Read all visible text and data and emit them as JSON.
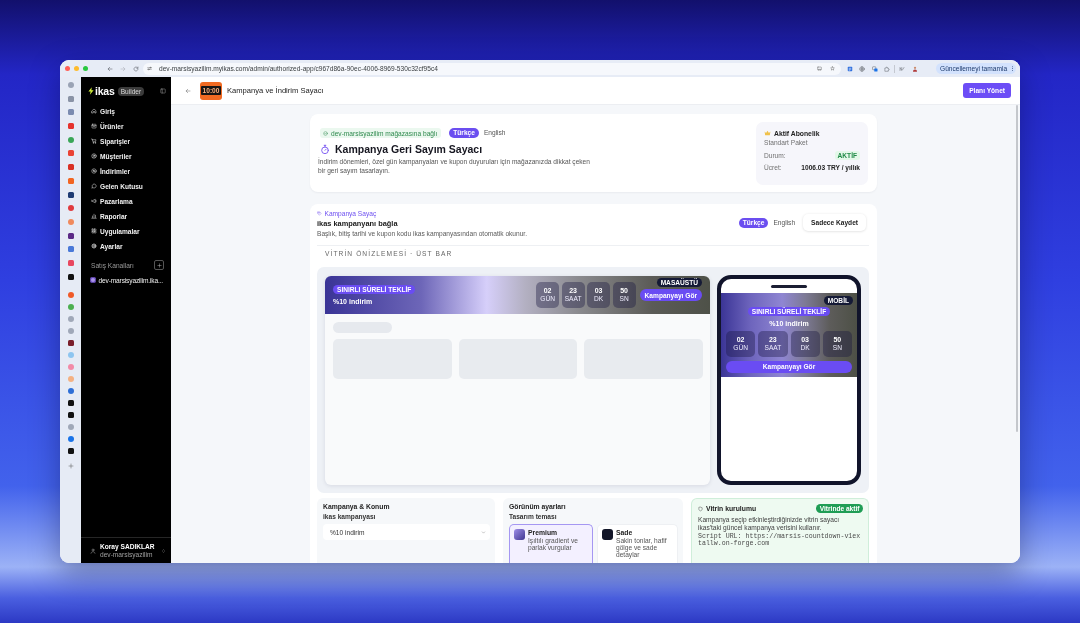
{
  "browser": {
    "url": "dev-marsisyazilim.myikas.com/admin/authorized-app/c967d86a-90ec-4006-8969-530c32cf95c4",
    "update_button": "Güncellemeyi tamamla"
  },
  "sidebar": {
    "brand": "ikas",
    "badge": "Builder",
    "items": [
      {
        "label": "Giriş"
      },
      {
        "label": "Ürünler"
      },
      {
        "label": "Siparişler"
      },
      {
        "label": "Müşteriler"
      },
      {
        "label": "İndirimler"
      },
      {
        "label": "Gelen Kutusu"
      },
      {
        "label": "Pazarlama"
      },
      {
        "label": "Raporlar"
      },
      {
        "label": "Uygulamalar"
      },
      {
        "label": "Ayarlar"
      }
    ],
    "channels_title": "Satış Kanalları",
    "channels": [
      {
        "label": "dev-marsisyazilim.ika..."
      }
    ],
    "user": {
      "name": "Koray SADIKLAR",
      "store": "dev-marsisyazilim"
    }
  },
  "header": {
    "app_icon_text": "10:00",
    "title": "Kampanya ve İndirim Sayacı",
    "button": "Planı Yönet"
  },
  "hero": {
    "connection": "dev-marsisyazilim mağazasına bağlı",
    "languages": [
      {
        "label": "Türkçe",
        "selected": true
      },
      {
        "label": "English",
        "selected": false
      }
    ],
    "title": "Kampanya Geri Sayım Sayacı",
    "description_lines": [
      "İndirim dönemleri, özel gün kampanyaları ve kupon duyuruları için mağazanızda dikkat çeken",
      "bir geri sayım tasarlayın."
    ]
  },
  "subscription": {
    "title": "Aktif Abonelik",
    "plan": "Standart Paket",
    "rows": [
      {
        "label": "Durum:",
        "value": "AKTİF",
        "kind": "badge"
      },
      {
        "label": "Ücret:",
        "value": "1006.03 TRY / yıllık",
        "kind": "text"
      }
    ]
  },
  "campaign": {
    "eyebrow": "Kampanya Sayaç",
    "title": "ikas kampanyanı bağla",
    "description": "Başlık, bitiş tarihi ve kupon kodu ikas kampanyasından otomatik okunur.",
    "languages": [
      {
        "label": "Türkçe",
        "selected": true
      },
      {
        "label": "English",
        "selected": false
      }
    ],
    "save_button": "Sadece Kaydet",
    "preview_label": "VİTRİN ÖNİZLEMESİ · ÜST BAR"
  },
  "preview": {
    "desktop": {
      "badge": "MASAÜSTÜ",
      "tag": "SINIRLI SÜRELİ TEKLİF",
      "title": "%10 indirim",
      "countdown": [
        {
          "value": "02",
          "unit": "GÜN"
        },
        {
          "value": "23",
          "unit": "SAAT"
        },
        {
          "value": "03",
          "unit": "DK"
        },
        {
          "value": "50",
          "unit": "SN"
        }
      ],
      "button": "Kampanyayı Gör"
    },
    "mobile": {
      "badge": "MOBİL",
      "tag": "SINIRLI SÜRELİ TEKLİF",
      "title": "%10 indirim",
      "countdown": [
        {
          "value": "02",
          "unit": "GÜN"
        },
        {
          "value": "23",
          "unit": "SAAT"
        },
        {
          "value": "03",
          "unit": "DK"
        },
        {
          "value": "50",
          "unit": "SN"
        }
      ],
      "button": "Kampanyayı Gör"
    }
  },
  "settings": {
    "campaign": {
      "title": "Kampanya & Konum",
      "field_label": "ikas kampanyası",
      "value": "%10 indirim"
    },
    "appearance": {
      "title": "Görünüm ayarları",
      "field_label": "Tasarım teması",
      "themes": [
        {
          "name": "Premium",
          "description": "Işıltılı gradient ve parlak vurgular",
          "kind": "gradient",
          "selected": true
        },
        {
          "name": "Sade",
          "description": "Sakin tonlar, hafif gölge ve sade detaylar",
          "kind": "solid",
          "selected": false
        }
      ]
    },
    "install": {
      "title": "Vitrin kurulumu",
      "status": "Vitrinde aktif",
      "description": "Kampanya seçip etkinleştirdiğinizde vitrin sayacı ikas'taki güncel kampanya verisini kullanır.",
      "script_url": "Script URL: https://marsis-countdown-v1extallw.on-forge.com"
    }
  }
}
